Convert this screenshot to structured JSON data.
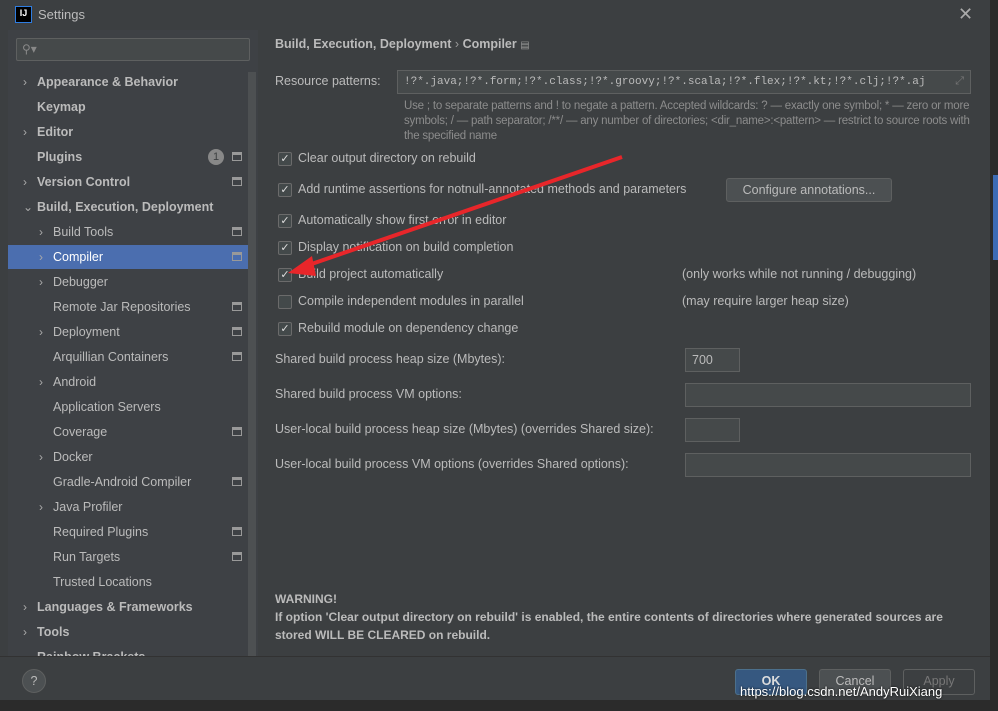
{
  "window": {
    "title": "Settings",
    "logo": "IJ"
  },
  "sidebar": {
    "search_placeholder": "",
    "items": [
      {
        "label": "Appearance & Behavior",
        "level": 0,
        "bold": true,
        "arrow": true
      },
      {
        "label": "Keymap",
        "level": 0,
        "bold": true
      },
      {
        "label": "Editor",
        "level": 0,
        "bold": true,
        "arrow": true
      },
      {
        "label": "Plugins",
        "level": 0,
        "bold": true,
        "badge": "1",
        "page": true
      },
      {
        "label": "Version Control",
        "level": 0,
        "bold": true,
        "arrow": true,
        "page": true
      },
      {
        "label": "Build, Execution, Deployment",
        "level": 0,
        "bold": true,
        "arrow": true,
        "expanded": true
      },
      {
        "label": "Build Tools",
        "level": 1,
        "arrow": true,
        "page": true
      },
      {
        "label": "Compiler",
        "level": 1,
        "arrow": true,
        "page": true,
        "selected": true
      },
      {
        "label": "Debugger",
        "level": 1,
        "arrow": true
      },
      {
        "label": "Remote Jar Repositories",
        "level": 1,
        "page": true
      },
      {
        "label": "Deployment",
        "level": 1,
        "arrow": true,
        "page": true
      },
      {
        "label": "Arquillian Containers",
        "level": 1,
        "page": true
      },
      {
        "label": "Android",
        "level": 1,
        "arrow": true
      },
      {
        "label": "Application Servers",
        "level": 1
      },
      {
        "label": "Coverage",
        "level": 1,
        "page": true
      },
      {
        "label": "Docker",
        "level": 1,
        "arrow": true
      },
      {
        "label": "Gradle-Android Compiler",
        "level": 1,
        "page": true
      },
      {
        "label": "Java Profiler",
        "level": 1,
        "arrow": true
      },
      {
        "label": "Required Plugins",
        "level": 1,
        "page": true
      },
      {
        "label": "Run Targets",
        "level": 1,
        "page": true
      },
      {
        "label": "Trusted Locations",
        "level": 1
      },
      {
        "label": "Languages & Frameworks",
        "level": 0,
        "bold": true,
        "arrow": true
      },
      {
        "label": "Tools",
        "level": 0,
        "bold": true,
        "arrow": true
      },
      {
        "label": "Rainbow Brackets",
        "level": 0,
        "bold": true
      }
    ]
  },
  "breadcrumb": [
    "Build, Execution, Deployment",
    "Compiler"
  ],
  "resource": {
    "label": "Resource patterns:",
    "value": "!?*.java;!?*.form;!?*.class;!?*.groovy;!?*.scala;!?*.flex;!?*.kt;!?*.clj;!?*.aj",
    "hint1": "Use ; to separate patterns and ! to negate a pattern. Accepted wildcards: ? — exactly one symbol; * — zero",
    "hint2": "or more symbols; / — path separator; /**/ — any number of directories; <dir_name>:<pattern> — restrict to",
    "hint3": "source roots with the specified name"
  },
  "options": [
    {
      "label": "Clear output directory on rebuild",
      "checked": true
    },
    {
      "label": "Add runtime assertions for notnull-annotated methods and parameters",
      "checked": true
    },
    {
      "label": "Automatically show first error in editor",
      "checked": true
    },
    {
      "label": "Display notification on build completion",
      "checked": true
    },
    {
      "label": "Build project automatically",
      "checked": true,
      "note": "(only works while not running / debugging)"
    },
    {
      "label": "Compile independent modules in parallel",
      "checked": false,
      "note": "(may require larger heap size)"
    },
    {
      "label": "Rebuild module on dependency change",
      "checked": true
    }
  ],
  "configure_button": "Configure annotations...",
  "fields": [
    {
      "label": "Shared build process heap size (Mbytes):",
      "value": "700"
    },
    {
      "label": "Shared build process VM options:",
      "value": ""
    },
    {
      "label": "User-local build process heap size (Mbytes) (overrides Shared size):",
      "value": ""
    },
    {
      "label": "User-local build process VM options (overrides Shared options):",
      "value": ""
    }
  ],
  "warning": {
    "title": "WARNING!",
    "line1": "If option 'Clear output directory on rebuild' is enabled, the entire contents of directories where generated",
    "line2": "sources are stored WILL BE CLEARED on rebuild."
  },
  "footer": {
    "help": "?",
    "ok": "OK",
    "cancel": "Cancel",
    "apply": "Apply"
  },
  "watermark": "https://blog.csdn.net/AndyRuiXiang",
  "colors": {
    "selection": "#4b6eaf",
    "ok": "#365880",
    "arrow": "#e8262a"
  }
}
